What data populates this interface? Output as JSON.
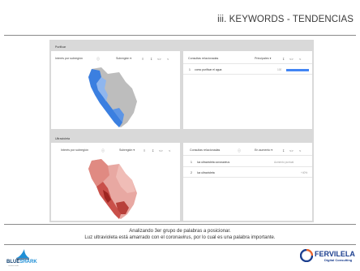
{
  "header": {
    "title": "iii. KEYWORDS - TENDENCIAS"
  },
  "section1": {
    "label": "Purificar",
    "left_card": {
      "title": "Interés por subregión",
      "dropdown": "Subregión"
    },
    "right_card": {
      "title": "Consultas relacionadas",
      "dropdown": "Principales",
      "rows": [
        {
          "num": "1",
          "text": "como purificar el agua",
          "value": "100"
        }
      ]
    }
  },
  "section2": {
    "label": "Ultravioleta",
    "left_card": {
      "title": "Interés por subregión",
      "dropdown": "Subregión"
    },
    "right_card": {
      "title": "Consultas relacionadas",
      "dropdown": "En aumento",
      "rows": [
        {
          "num": "1",
          "text": "luz ultravioleta coronavirus",
          "value": "Aumento puntual"
        },
        {
          "num": "2",
          "text": "luz ultravioleta",
          "value": "+40%"
        }
      ]
    }
  },
  "footer": {
    "line1": "Analizando 3er grupo de palabras a posicionar.",
    "line2": "Luz ultravioleta está amarrado con el coronavirus, por lo cual es una palabra importante."
  },
  "logos": {
    "left": {
      "part1": "BLUE",
      "part2": "SHARK",
      "sub": "creative studio"
    },
    "right": {
      "name": "FERVILELA",
      "sub": "Digital Consulting"
    }
  },
  "colors": {
    "blue_map": "#3b7fe0",
    "red_map": "#c9504a",
    "dark_red": "#9e2520",
    "bar_blue": "#4285f4"
  }
}
